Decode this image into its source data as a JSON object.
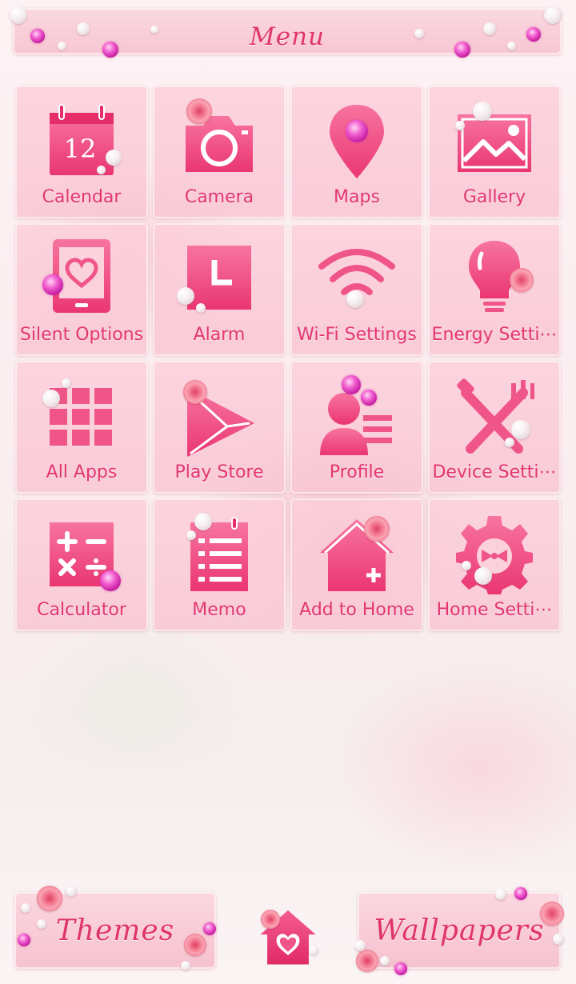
{
  "header": {
    "title": "Menu"
  },
  "apps": [
    {
      "label": "Calendar",
      "icon": "calendar-icon",
      "icon_text": "12"
    },
    {
      "label": "Camera",
      "icon": "camera-icon"
    },
    {
      "label": "Maps",
      "icon": "map-pin-icon"
    },
    {
      "label": "Gallery",
      "icon": "gallery-icon"
    },
    {
      "label": "Silent Options",
      "icon": "tablet-heart-icon"
    },
    {
      "label": "Alarm",
      "icon": "clock-icon"
    },
    {
      "label": "Wi-Fi Settings",
      "icon": "wifi-icon"
    },
    {
      "label": "Energy Setti⋯",
      "icon": "lightbulb-icon"
    },
    {
      "label": "All Apps",
      "icon": "grid-icon"
    },
    {
      "label": "Play Store",
      "icon": "play-store-icon"
    },
    {
      "label": "Profile",
      "icon": "profile-icon"
    },
    {
      "label": "Device Setti⋯",
      "icon": "tools-icon"
    },
    {
      "label": "Calculator",
      "icon": "calculator-icon"
    },
    {
      "label": "Memo",
      "icon": "memo-icon"
    },
    {
      "label": "Add to Home",
      "icon": "add-home-icon"
    },
    {
      "label": "Home Setti⋯",
      "icon": "gear-bow-icon"
    }
  ],
  "footer": {
    "themes_label": "Themes",
    "wallpapers_label": "Wallpapers",
    "home_icon": "home-heart-icon"
  },
  "colors": {
    "accent": "#e23570",
    "icon_fill": "#f04a82",
    "tile": "#f9cad6"
  }
}
